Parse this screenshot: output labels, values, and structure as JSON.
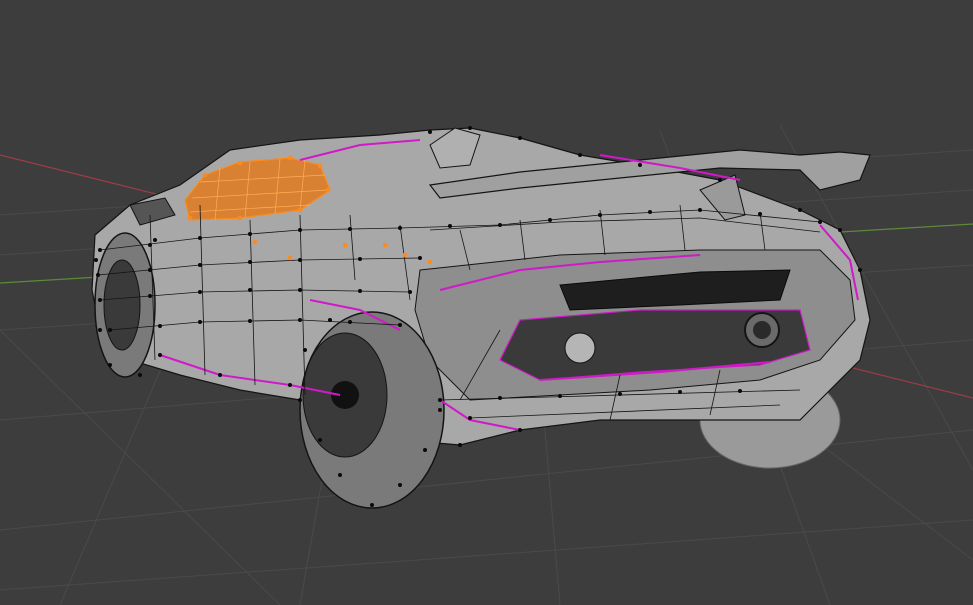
{
  "viewport": {
    "mode": "edit-mode",
    "shading": "solid-with-wireframe-overlay",
    "object": "sports-car-mesh",
    "colors": {
      "background": "#3d3d3d",
      "grid": "#4a4a4a",
      "x_axis": "#9b3c46",
      "y_axis": "#5c8a3a",
      "mesh_body": "#a8a8a8",
      "mesh_dark": "#5a5a5a",
      "wire": "#141414",
      "vertex": "#0a0a0a",
      "seam": "#d019c9",
      "selected_face": "#e07a1e",
      "selected_vertex": "#ff8a1a"
    }
  }
}
